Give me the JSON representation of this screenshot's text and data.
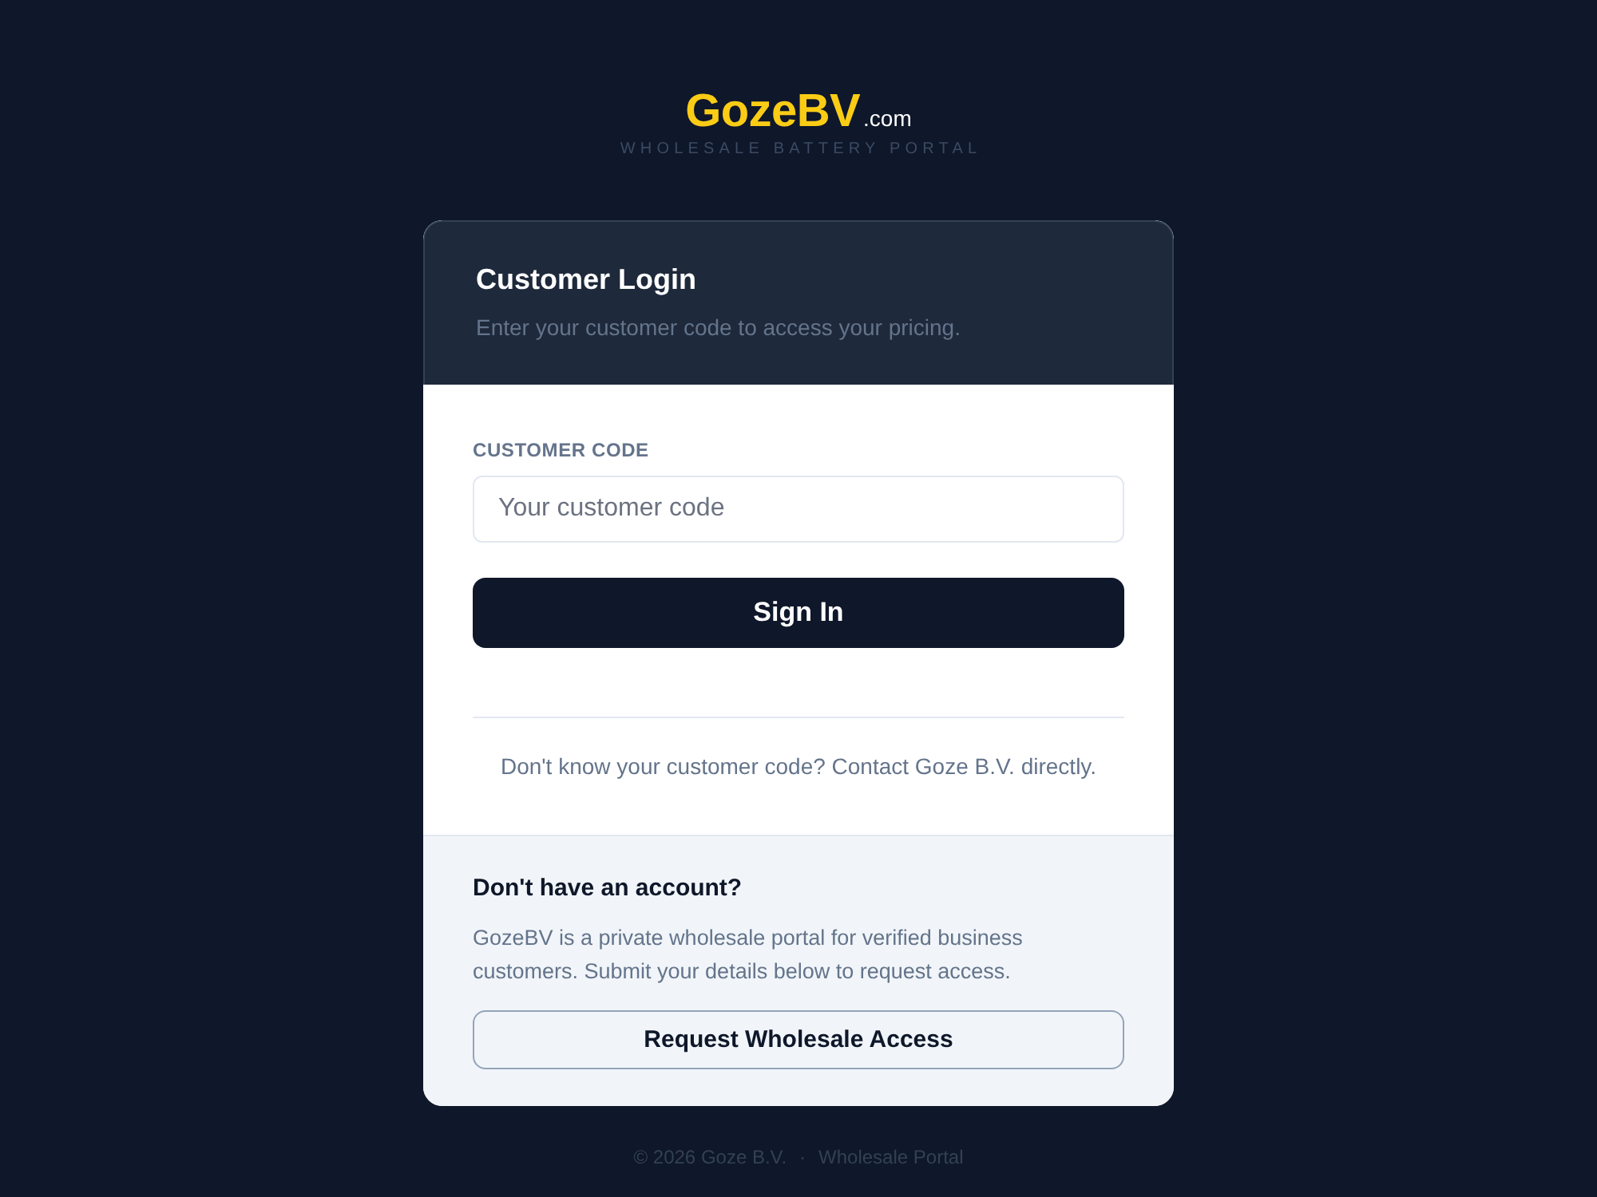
{
  "logo": {
    "name": "GozeBV",
    "suffix": ".com",
    "tagline": "WHOLESALE BATTERY PORTAL"
  },
  "login": {
    "title": "Customer Login",
    "subtitle": "Enter your customer code to access your pricing.",
    "field_label": "CUSTOMER CODE",
    "placeholder": "Your customer code",
    "submit": "Sign In",
    "help": "Don't know your customer code? Contact Goze B.V. directly."
  },
  "signup": {
    "title": "Don't have an account?",
    "text": "GozeBV is a private wholesale portal for verified business customers. Submit your details below to request access.",
    "button": "Request Wholesale Access"
  },
  "footer": {
    "copyright": "© 2026 Goze B.V.",
    "separator": "·",
    "link": "Wholesale Portal"
  }
}
